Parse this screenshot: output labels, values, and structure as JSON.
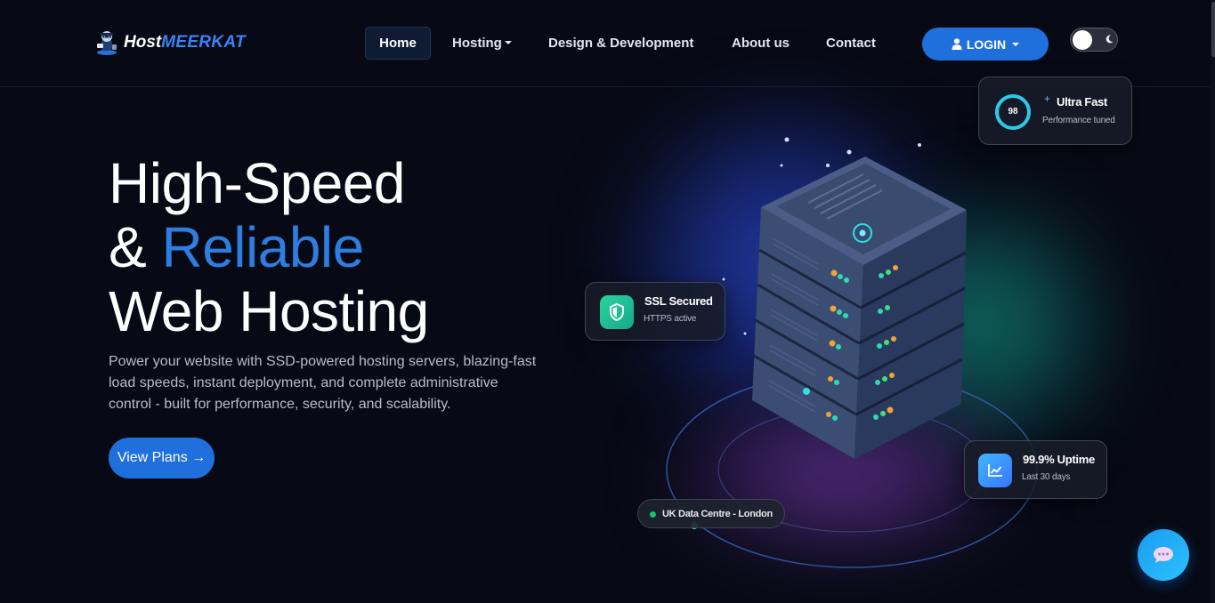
{
  "brand": {
    "host": "Host",
    "meerkat": "MEERKAT"
  },
  "nav": {
    "items": [
      {
        "label": "Home",
        "active": true
      },
      {
        "label": "Hosting",
        "dropdown": true
      },
      {
        "label": "Design & Development"
      },
      {
        "label": "About us"
      },
      {
        "label": "Contact"
      }
    ],
    "login_label": "LOGIN"
  },
  "hero": {
    "line1": "High-Speed",
    "line2_prefix": "& ",
    "line2_accent": "Reliable",
    "line3": "Web Hosting",
    "description": "Power your website with SSD-powered hosting servers, blazing-fast load speeds, instant deployment, and complete administrative control - built for performance, security, and scalability.",
    "cta_label": "View Plans →"
  },
  "cards": {
    "speed": {
      "score": "98",
      "score_fraction": 0.98,
      "title": "Ultra Fast",
      "subtitle": "Performance tuned"
    },
    "ssl": {
      "title": "SSL Secured",
      "subtitle": "HTTPS active"
    },
    "uptime": {
      "title": "99.9% Uptime",
      "subtitle": "Last 30 days"
    },
    "datacenter": {
      "label": "UK Data Centre - London"
    }
  },
  "colors": {
    "accent": "#2d7ee0",
    "button": "#1f6fdc",
    "background": "#070a14",
    "ssl_green": "#2ad3a0",
    "uptime_blue": "#3576ff"
  },
  "icons": {
    "logo": "meerkat-logo-icon",
    "user": "user-icon",
    "moon": "moon-icon",
    "shield": "shield-icon",
    "chart": "chart-icon",
    "chat": "chat-icon"
  }
}
